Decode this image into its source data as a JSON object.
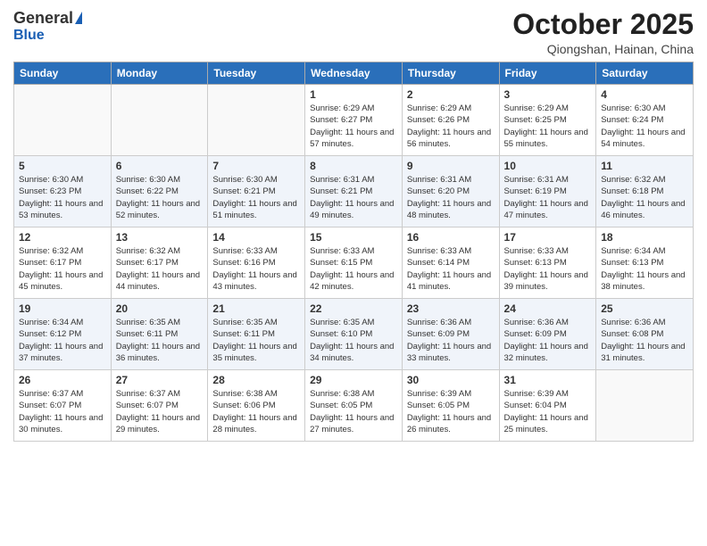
{
  "header": {
    "logo_general": "General",
    "logo_blue": "Blue",
    "month_title": "October 2025",
    "location": "Qiongshan, Hainan, China"
  },
  "weekdays": [
    "Sunday",
    "Monday",
    "Tuesday",
    "Wednesday",
    "Thursday",
    "Friday",
    "Saturday"
  ],
  "weeks": [
    [
      {
        "day": "",
        "sunrise": "",
        "sunset": "",
        "daylight": "",
        "empty": true
      },
      {
        "day": "",
        "sunrise": "",
        "sunset": "",
        "daylight": "",
        "empty": true
      },
      {
        "day": "",
        "sunrise": "",
        "sunset": "",
        "daylight": "",
        "empty": true
      },
      {
        "day": "1",
        "sunrise": "Sunrise: 6:29 AM",
        "sunset": "Sunset: 6:27 PM",
        "daylight": "Daylight: 11 hours and 57 minutes.",
        "empty": false
      },
      {
        "day": "2",
        "sunrise": "Sunrise: 6:29 AM",
        "sunset": "Sunset: 6:26 PM",
        "daylight": "Daylight: 11 hours and 56 minutes.",
        "empty": false
      },
      {
        "day": "3",
        "sunrise": "Sunrise: 6:29 AM",
        "sunset": "Sunset: 6:25 PM",
        "daylight": "Daylight: 11 hours and 55 minutes.",
        "empty": false
      },
      {
        "day": "4",
        "sunrise": "Sunrise: 6:30 AM",
        "sunset": "Sunset: 6:24 PM",
        "daylight": "Daylight: 11 hours and 54 minutes.",
        "empty": false
      }
    ],
    [
      {
        "day": "5",
        "sunrise": "Sunrise: 6:30 AM",
        "sunset": "Sunset: 6:23 PM",
        "daylight": "Daylight: 11 hours and 53 minutes.",
        "empty": false
      },
      {
        "day": "6",
        "sunrise": "Sunrise: 6:30 AM",
        "sunset": "Sunset: 6:22 PM",
        "daylight": "Daylight: 11 hours and 52 minutes.",
        "empty": false
      },
      {
        "day": "7",
        "sunrise": "Sunrise: 6:30 AM",
        "sunset": "Sunset: 6:21 PM",
        "daylight": "Daylight: 11 hours and 51 minutes.",
        "empty": false
      },
      {
        "day": "8",
        "sunrise": "Sunrise: 6:31 AM",
        "sunset": "Sunset: 6:21 PM",
        "daylight": "Daylight: 11 hours and 49 minutes.",
        "empty": false
      },
      {
        "day": "9",
        "sunrise": "Sunrise: 6:31 AM",
        "sunset": "Sunset: 6:20 PM",
        "daylight": "Daylight: 11 hours and 48 minutes.",
        "empty": false
      },
      {
        "day": "10",
        "sunrise": "Sunrise: 6:31 AM",
        "sunset": "Sunset: 6:19 PM",
        "daylight": "Daylight: 11 hours and 47 minutes.",
        "empty": false
      },
      {
        "day": "11",
        "sunrise": "Sunrise: 6:32 AM",
        "sunset": "Sunset: 6:18 PM",
        "daylight": "Daylight: 11 hours and 46 minutes.",
        "empty": false
      }
    ],
    [
      {
        "day": "12",
        "sunrise": "Sunrise: 6:32 AM",
        "sunset": "Sunset: 6:17 PM",
        "daylight": "Daylight: 11 hours and 45 minutes.",
        "empty": false
      },
      {
        "day": "13",
        "sunrise": "Sunrise: 6:32 AM",
        "sunset": "Sunset: 6:17 PM",
        "daylight": "Daylight: 11 hours and 44 minutes.",
        "empty": false
      },
      {
        "day": "14",
        "sunrise": "Sunrise: 6:33 AM",
        "sunset": "Sunset: 6:16 PM",
        "daylight": "Daylight: 11 hours and 43 minutes.",
        "empty": false
      },
      {
        "day": "15",
        "sunrise": "Sunrise: 6:33 AM",
        "sunset": "Sunset: 6:15 PM",
        "daylight": "Daylight: 11 hours and 42 minutes.",
        "empty": false
      },
      {
        "day": "16",
        "sunrise": "Sunrise: 6:33 AM",
        "sunset": "Sunset: 6:14 PM",
        "daylight": "Daylight: 11 hours and 41 minutes.",
        "empty": false
      },
      {
        "day": "17",
        "sunrise": "Sunrise: 6:33 AM",
        "sunset": "Sunset: 6:13 PM",
        "daylight": "Daylight: 11 hours and 39 minutes.",
        "empty": false
      },
      {
        "day": "18",
        "sunrise": "Sunrise: 6:34 AM",
        "sunset": "Sunset: 6:13 PM",
        "daylight": "Daylight: 11 hours and 38 minutes.",
        "empty": false
      }
    ],
    [
      {
        "day": "19",
        "sunrise": "Sunrise: 6:34 AM",
        "sunset": "Sunset: 6:12 PM",
        "daylight": "Daylight: 11 hours and 37 minutes.",
        "empty": false
      },
      {
        "day": "20",
        "sunrise": "Sunrise: 6:35 AM",
        "sunset": "Sunset: 6:11 PM",
        "daylight": "Daylight: 11 hours and 36 minutes.",
        "empty": false
      },
      {
        "day": "21",
        "sunrise": "Sunrise: 6:35 AM",
        "sunset": "Sunset: 6:11 PM",
        "daylight": "Daylight: 11 hours and 35 minutes.",
        "empty": false
      },
      {
        "day": "22",
        "sunrise": "Sunrise: 6:35 AM",
        "sunset": "Sunset: 6:10 PM",
        "daylight": "Daylight: 11 hours and 34 minutes.",
        "empty": false
      },
      {
        "day": "23",
        "sunrise": "Sunrise: 6:36 AM",
        "sunset": "Sunset: 6:09 PM",
        "daylight": "Daylight: 11 hours and 33 minutes.",
        "empty": false
      },
      {
        "day": "24",
        "sunrise": "Sunrise: 6:36 AM",
        "sunset": "Sunset: 6:09 PM",
        "daylight": "Daylight: 11 hours and 32 minutes.",
        "empty": false
      },
      {
        "day": "25",
        "sunrise": "Sunrise: 6:36 AM",
        "sunset": "Sunset: 6:08 PM",
        "daylight": "Daylight: 11 hours and 31 minutes.",
        "empty": false
      }
    ],
    [
      {
        "day": "26",
        "sunrise": "Sunrise: 6:37 AM",
        "sunset": "Sunset: 6:07 PM",
        "daylight": "Daylight: 11 hours and 30 minutes.",
        "empty": false
      },
      {
        "day": "27",
        "sunrise": "Sunrise: 6:37 AM",
        "sunset": "Sunset: 6:07 PM",
        "daylight": "Daylight: 11 hours and 29 minutes.",
        "empty": false
      },
      {
        "day": "28",
        "sunrise": "Sunrise: 6:38 AM",
        "sunset": "Sunset: 6:06 PM",
        "daylight": "Daylight: 11 hours and 28 minutes.",
        "empty": false
      },
      {
        "day": "29",
        "sunrise": "Sunrise: 6:38 AM",
        "sunset": "Sunset: 6:05 PM",
        "daylight": "Daylight: 11 hours and 27 minutes.",
        "empty": false
      },
      {
        "day": "30",
        "sunrise": "Sunrise: 6:39 AM",
        "sunset": "Sunset: 6:05 PM",
        "daylight": "Daylight: 11 hours and 26 minutes.",
        "empty": false
      },
      {
        "day": "31",
        "sunrise": "Sunrise: 6:39 AM",
        "sunset": "Sunset: 6:04 PM",
        "daylight": "Daylight: 11 hours and 25 minutes.",
        "empty": false
      },
      {
        "day": "",
        "sunrise": "",
        "sunset": "",
        "daylight": "",
        "empty": true
      }
    ]
  ]
}
